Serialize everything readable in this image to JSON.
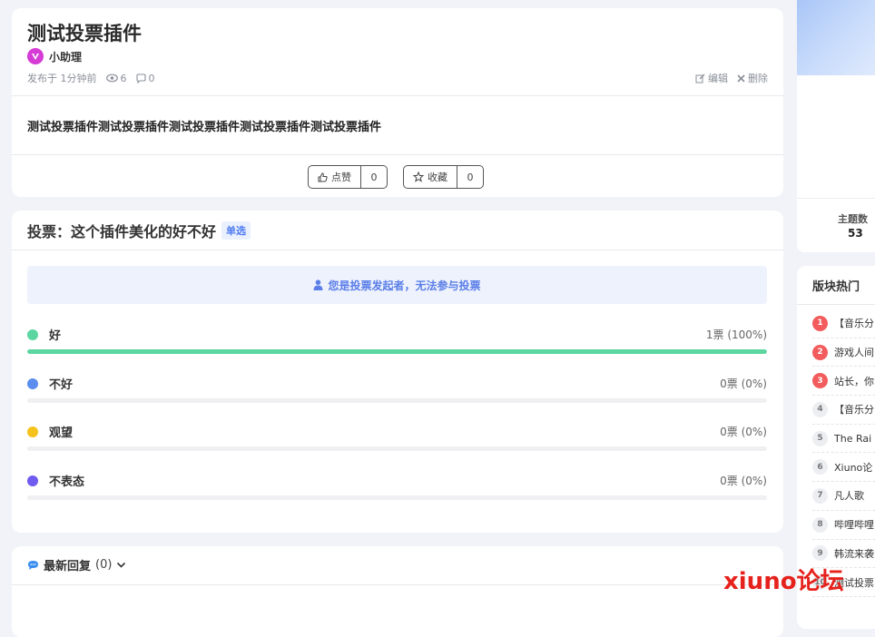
{
  "post": {
    "title": "测试投票插件",
    "author": "小助理",
    "published": "发布于 1分钟前",
    "views": "6",
    "comments": "0",
    "edit_label": "编辑",
    "delete_label": "删除",
    "content": "测试投票插件测试投票插件测试投票插件测试投票插件测试投票插件",
    "like_label": "点赞",
    "like_count": "0",
    "fav_label": "收藏",
    "fav_count": "0"
  },
  "poll": {
    "title": "投票：这个插件美化的好不好",
    "mode": "单选",
    "notice": "您是投票发起者，无法参与投票",
    "options": [
      {
        "label": "好",
        "count": "1票 (100%)",
        "percent": 100,
        "color": "#5bd6a0"
      },
      {
        "label": "不好",
        "count": "0票 (0%)",
        "percent": 0,
        "color": "#5b8def"
      },
      {
        "label": "观望",
        "count": "0票 (0%)",
        "percent": 0,
        "color": "#f5c21b"
      },
      {
        "label": "不表态",
        "count": "0票 (0%)",
        "percent": 0,
        "color": "#6f5bf0"
      }
    ]
  },
  "replies": {
    "title": "最新回复",
    "count": "(0)"
  },
  "sidebar": {
    "stat_label": "主题数",
    "stat_value": "53",
    "hot_title": "版块热门",
    "hot_items": [
      {
        "rank": "1",
        "title": "【音乐分"
      },
      {
        "rank": "2",
        "title": "游戏人间"
      },
      {
        "rank": "3",
        "title": "站长，你"
      },
      {
        "rank": "4",
        "title": "【音乐分"
      },
      {
        "rank": "5",
        "title": "The Rai"
      },
      {
        "rank": "6",
        "title": "Xiuno论"
      },
      {
        "rank": "7",
        "title": "凡人歌"
      },
      {
        "rank": "8",
        "title": "哔哩哔哩"
      },
      {
        "rank": "9",
        "title": "韩流来袭"
      },
      {
        "rank": "10",
        "title": "测试投票"
      }
    ]
  },
  "watermark": "xiuno论坛",
  "colors": {
    "accent": "#5b7fe8",
    "hot_rank": "#f25c5c"
  }
}
